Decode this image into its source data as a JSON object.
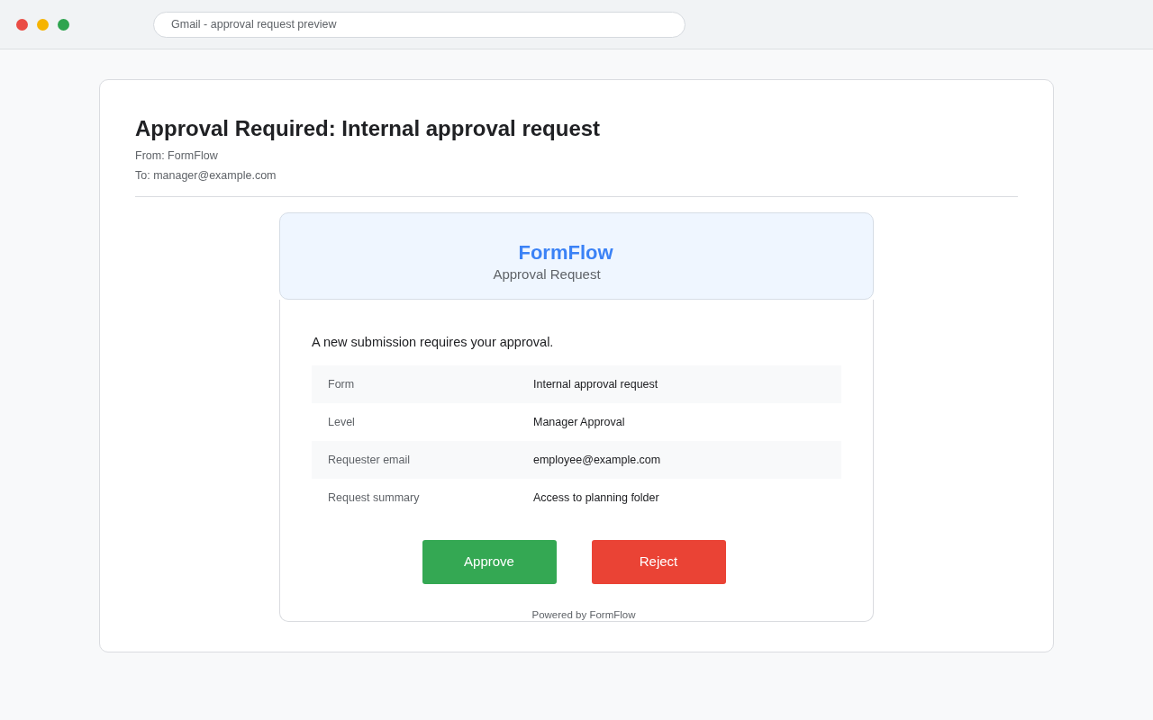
{
  "browser": {
    "address_bar": "Gmail - approval request preview"
  },
  "email": {
    "subject": "Approval Required: Internal approval request",
    "from": "From: FormFlow",
    "to": "To: manager@example.com",
    "message": {
      "brand": "FormFlow",
      "header_subtitle": "Approval Request",
      "intro": "A new submission requires your approval.",
      "details": [
        {
          "label": "Form",
          "value": "Internal approval request"
        },
        {
          "label": "Level",
          "value": "Manager Approval"
        },
        {
          "label": "Requester email",
          "value": "employee@example.com"
        },
        {
          "label": "Request summary",
          "value": "Access to planning folder"
        }
      ],
      "actions": [
        {
          "label": "Approve",
          "kind": "approve"
        },
        {
          "label": "Reject",
          "kind": "reject"
        }
      ],
      "footer": "Powered by FormFlow"
    }
  }
}
